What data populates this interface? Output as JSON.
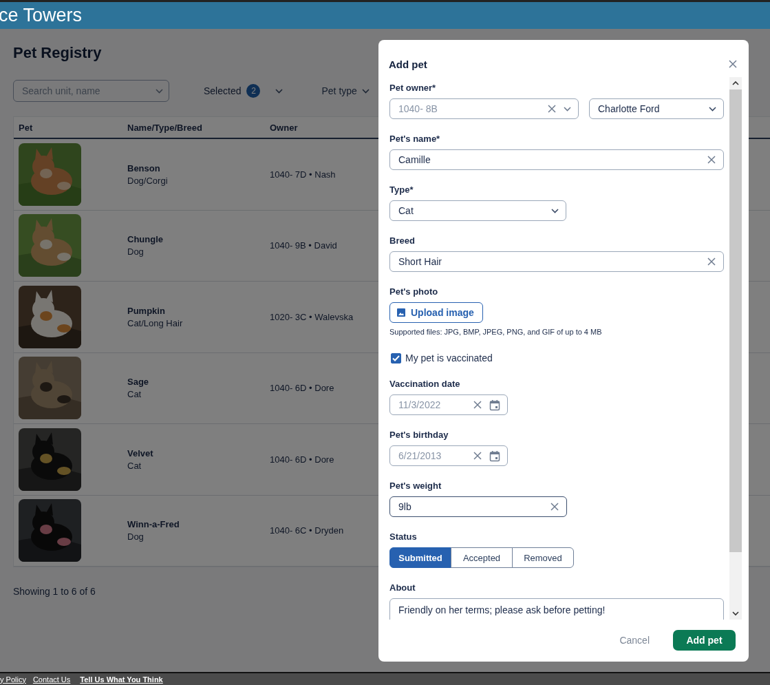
{
  "header": {
    "title": "ce Towers"
  },
  "page": {
    "title": "Pet Registry",
    "search": {
      "placeholder": "Search unit, name"
    },
    "selected_filter": {
      "label": "Selected",
      "count": "2"
    },
    "pet_type_filter": {
      "label": "Pet type"
    }
  },
  "table": {
    "columns": [
      "Pet",
      "Name/Type/Breed",
      "Owner"
    ],
    "rows": [
      {
        "name": "Benson",
        "type": "Dog/Corgi",
        "owner": "1040- 7D • Nash"
      },
      {
        "name": "Chungle",
        "type": "Dog",
        "owner": "1040- 9B • David"
      },
      {
        "name": "Pumpkin",
        "type": "Cat/Long Hair",
        "owner": "1020- 3C • Walevska"
      },
      {
        "name": "Sage",
        "type": "Cat",
        "owner": "1040- 6D • Dore"
      },
      {
        "name": "Velvet",
        "type": "Cat",
        "owner": "1040- 6D • Dore"
      },
      {
        "name": "Winn-a-Fred",
        "type": "Dog",
        "owner": "1040- 6C • Dryden"
      }
    ]
  },
  "showing": "Showing 1 to 6 of 6",
  "footer_links": [
    {
      "label": "y Policy",
      "bold": false
    },
    {
      "label": "Contact Us",
      "bold": false
    },
    {
      "label": "Tell Us What You Think",
      "bold": true
    }
  ],
  "dialog": {
    "title": "Add pet",
    "owner": {
      "label": "Pet owner*",
      "unit": "1040- 8B",
      "name": "Charlotte Ford"
    },
    "pet_name": {
      "label": "Pet's name*",
      "value": "Camille"
    },
    "type": {
      "label": "Type*",
      "value": "Cat"
    },
    "breed": {
      "label": "Breed",
      "value": "Short Hair"
    },
    "photo": {
      "label": "Pet's photo",
      "button": "Upload image",
      "hint": "Supported files: JPG, BMP, JPEG, PNG, and GIF of up to 4 MB"
    },
    "vaccinated": {
      "label": "My pet is vaccinated",
      "checked": true
    },
    "vaccination_date": {
      "label": "Vaccination date",
      "value": "11/3/2022"
    },
    "birthday": {
      "label": "Pet's birthday",
      "value": "6/21/2013"
    },
    "weight": {
      "label": "Pet's weight",
      "value": "9lb",
      "focused": true
    },
    "status": {
      "label": "Status",
      "options": [
        {
          "label": "Submitted",
          "selected": true
        },
        {
          "label": "Accepted",
          "selected": false
        },
        {
          "label": "Removed",
          "selected": false
        }
      ]
    },
    "about": {
      "label": "About",
      "value": "Friendly on her terms; please ask before petting!"
    },
    "cancel": "Cancel",
    "submit": "Add pet"
  }
}
